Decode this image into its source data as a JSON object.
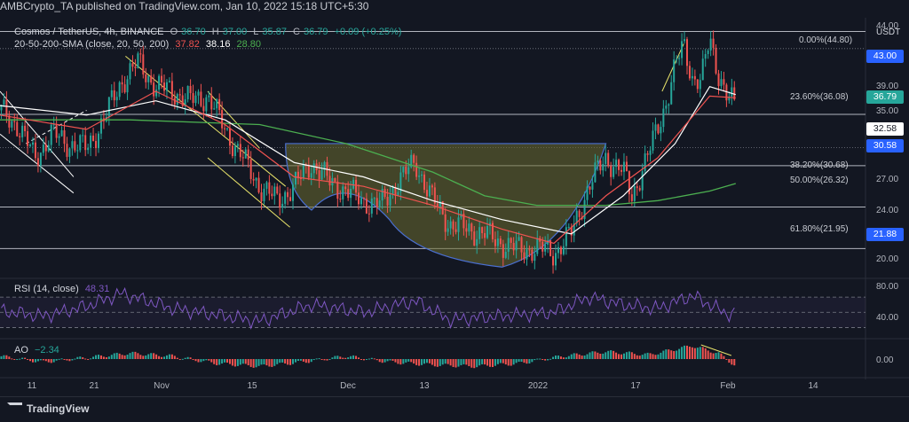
{
  "header": {
    "published": "AMBCrypto_TA published on TradingView.com, Jan 10, 2022 15:18 UTC+5:30"
  },
  "legend": {
    "symbol": "Cosmos / TetherUS, 4h, BINANCE",
    "o_label": "O",
    "o": "36.70",
    "h_label": "H",
    "h": "37.00",
    "l_label": "L",
    "l": "35.87",
    "c_label": "C",
    "c": "36.79",
    "change": "+0.09 (+0.25%)",
    "sma_label": "20-50-200-SMA (close, 20, 50, 200)",
    "sma20": "37.82",
    "sma50": "38.16",
    "sma200": "28.80",
    "rsi_label": "RSI (14, close)",
    "rsi_value": "48.31",
    "ao_label": "AO",
    "ao_value": "−2.34"
  },
  "currency": "USDT",
  "colors": {
    "bg": "#131722",
    "up": "#26a69a",
    "down": "#ef5350",
    "sma20": "#ffffff",
    "sma50": "#ef5350",
    "sma200": "#4caf50",
    "rsi": "#7e57c2",
    "tag_blue": "#2962ff",
    "cup_fill": "#6b6b2f",
    "wedge": "#e8e36a"
  },
  "price_axis_labels": [
    "44.00",
    "39.00",
    "35.00",
    "27.00",
    "24.00",
    "20.00"
  ],
  "price_tags": [
    {
      "value": "43.00",
      "style": "blue"
    },
    {
      "value": "36.79",
      "style": "green"
    },
    {
      "value": "32.58",
      "style": "white"
    },
    {
      "value": "30.58",
      "style": "blue"
    },
    {
      "value": "21.88",
      "style": "blue"
    }
  ],
  "fib_levels": [
    {
      "label": "0.00%(44.80)",
      "price": 44.8
    },
    {
      "label": "23.60%(36.08)",
      "price": 36.08
    },
    {
      "label": "38.20%(30.68)",
      "price": 30.68
    },
    {
      "label": "50.00%(26.32)",
      "price": 26.32
    },
    {
      "label": "61.80%(21.95)",
      "price": 21.95
    }
  ],
  "rsi_axis_labels": [
    "80.00",
    "40.00"
  ],
  "ao_axis_labels": [
    "0.00"
  ],
  "x_axis_labels": [
    "11",
    "21",
    "Nov",
    "15",
    "Dec",
    "13",
    "2022",
    "17",
    "Feb",
    "14"
  ],
  "chart_data": {
    "type": "candlestick",
    "title": "Cosmos / TetherUS, 4h, BINANCE",
    "y_range": [
      19.0,
      45.5
    ],
    "close_path": [
      [
        0,
        36.5
      ],
      [
        0.02,
        35.0
      ],
      [
        0.04,
        31.5
      ],
      [
        0.06,
        34.0
      ],
      [
        0.08,
        33.0
      ],
      [
        0.1,
        32.5
      ],
      [
        0.12,
        35.5
      ],
      [
        0.14,
        39.5
      ],
      [
        0.16,
        41.5
      ],
      [
        0.18,
        39.0
      ],
      [
        0.2,
        38.5
      ],
      [
        0.22,
        37.5
      ],
      [
        0.24,
        38.0
      ],
      [
        0.26,
        34.5
      ],
      [
        0.28,
        31.5
      ],
      [
        0.3,
        28.5
      ],
      [
        0.32,
        27.0
      ],
      [
        0.34,
        28.5
      ],
      [
        0.36,
        31.0
      ],
      [
        0.38,
        29.0
      ],
      [
        0.4,
        28.0
      ],
      [
        0.42,
        27.0
      ],
      [
        0.44,
        26.5
      ],
      [
        0.46,
        29.0
      ],
      [
        0.48,
        31.0
      ],
      [
        0.5,
        27.0
      ],
      [
        0.52,
        24.5
      ],
      [
        0.54,
        24.0
      ],
      [
        0.56,
        23.5
      ],
      [
        0.58,
        22.5
      ],
      [
        0.6,
        21.8
      ],
      [
        0.62,
        22.0
      ],
      [
        0.64,
        21.5
      ],
      [
        0.66,
        23.5
      ],
      [
        0.68,
        28.5
      ],
      [
        0.7,
        31.5
      ],
      [
        0.72,
        30.0
      ],
      [
        0.73,
        27.5
      ],
      [
        0.75,
        32.0
      ],
      [
        0.77,
        37.5
      ],
      [
        0.78,
        41.0
      ],
      [
        0.79,
        43.5
      ],
      [
        0.8,
        40.0
      ],
      [
        0.81,
        39.5
      ],
      [
        0.82,
        44.0
      ],
      [
        0.83,
        40.5
      ],
      [
        0.84,
        38.0
      ],
      [
        0.85,
        36.79
      ]
    ],
    "sma20_path": [
      [
        0,
        36.0
      ],
      [
        0.1,
        34.5
      ],
      [
        0.18,
        38.5
      ],
      [
        0.26,
        35.0
      ],
      [
        0.34,
        29.5
      ],
      [
        0.42,
        28.5
      ],
      [
        0.5,
        26.5
      ],
      [
        0.58,
        24.0
      ],
      [
        0.64,
        22.5
      ],
      [
        0.7,
        27.5
      ],
      [
        0.76,
        31.5
      ],
      [
        0.82,
        38.0
      ],
      [
        0.85,
        37.82
      ]
    ],
    "sma50_path": [
      [
        0,
        37.0
      ],
      [
        0.1,
        36.0
      ],
      [
        0.18,
        37.5
      ],
      [
        0.26,
        35.5
      ],
      [
        0.34,
        31.0
      ],
      [
        0.42,
        29.5
      ],
      [
        0.5,
        27.0
      ],
      [
        0.58,
        25.0
      ],
      [
        0.66,
        23.5
      ],
      [
        0.72,
        27.5
      ],
      [
        0.78,
        33.0
      ],
      [
        0.82,
        39.0
      ],
      [
        0.85,
        38.16
      ]
    ],
    "sma200_path": [
      [
        0,
        35.5
      ],
      [
        0.15,
        35.5
      ],
      [
        0.3,
        35.0
      ],
      [
        0.4,
        33.0
      ],
      [
        0.5,
        30.0
      ],
      [
        0.56,
        27.5
      ],
      [
        0.62,
        26.5
      ],
      [
        0.7,
        26.5
      ],
      [
        0.76,
        27.0
      ],
      [
        0.82,
        28.0
      ],
      [
        0.85,
        28.8
      ]
    ],
    "rsi_range": [
      20,
      90
    ],
    "rsi_bands": [
      70,
      50,
      30
    ],
    "rsi_path": [
      [
        0,
        52
      ],
      [
        0.05,
        45
      ],
      [
        0.1,
        58
      ],
      [
        0.14,
        75
      ],
      [
        0.2,
        55
      ],
      [
        0.26,
        45
      ],
      [
        0.3,
        38
      ],
      [
        0.36,
        60
      ],
      [
        0.42,
        50
      ],
      [
        0.48,
        65
      ],
      [
        0.52,
        40
      ],
      [
        0.58,
        45
      ],
      [
        0.64,
        50
      ],
      [
        0.68,
        70
      ],
      [
        0.72,
        60
      ],
      [
        0.76,
        55
      ],
      [
        0.8,
        72
      ],
      [
        0.84,
        48
      ],
      [
        0.85,
        48.31
      ]
    ],
    "ao_range": [
      -6,
      6
    ],
    "ao_hist": [
      [
        0,
        1
      ],
      [
        0.05,
        -1
      ],
      [
        0.1,
        0.5
      ],
      [
        0.15,
        2
      ],
      [
        0.2,
        1
      ],
      [
        0.25,
        -1.5
      ],
      [
        0.3,
        -2.5
      ],
      [
        0.35,
        -1
      ],
      [
        0.4,
        1
      ],
      [
        0.45,
        -1
      ],
      [
        0.5,
        -2
      ],
      [
        0.55,
        -2.5
      ],
      [
        0.6,
        -1.5
      ],
      [
        0.65,
        1
      ],
      [
        0.7,
        2.5
      ],
      [
        0.75,
        1.5
      ],
      [
        0.8,
        4.5
      ],
      [
        0.83,
        2
      ],
      [
        0.85,
        -2.34
      ]
    ]
  }
}
